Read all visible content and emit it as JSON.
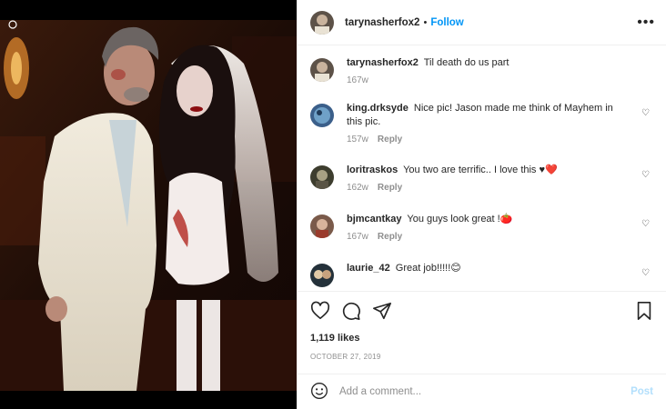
{
  "post": {
    "author": "tarynasherfox2",
    "follow_label": "Follow",
    "separator": "•",
    "more_label": "•••"
  },
  "comments": [
    {
      "user": "tarynasherfox2",
      "text": "Til death do us part",
      "age": "167w",
      "reply": "",
      "liked_icon": false
    },
    {
      "user": "king.drksyde",
      "text": "Nice pic! Jason made me think of Mayhem in this pic.",
      "age": "157w",
      "reply": "Reply",
      "liked_icon": true
    },
    {
      "user": "loritraskos",
      "text": "You two are terrific.. I love this ♥❤️",
      "age": "162w",
      "reply": "Reply",
      "liked_icon": true
    },
    {
      "user": "bjmcantkay",
      "text": "You guys look great !🍅",
      "age": "167w",
      "reply": "Reply",
      "liked_icon": true
    },
    {
      "user": "laurie_42",
      "text": "Great job!!!!!😊",
      "age": "",
      "reply": "",
      "liked_icon": true
    }
  ],
  "engagement": {
    "likes": "1,119 likes",
    "date": "OCTOBER 27, 2019"
  },
  "composer": {
    "placeholder": "Add a comment...",
    "post_label": "Post"
  },
  "icons": {
    "like": "heart-icon",
    "comment": "comment-icon",
    "share": "share-icon",
    "save": "bookmark-icon",
    "emoji": "emoji-icon"
  },
  "colors": {
    "accent": "#0095f6",
    "muted": "#8e8e8e",
    "post_disabled": "#b2dffc"
  }
}
